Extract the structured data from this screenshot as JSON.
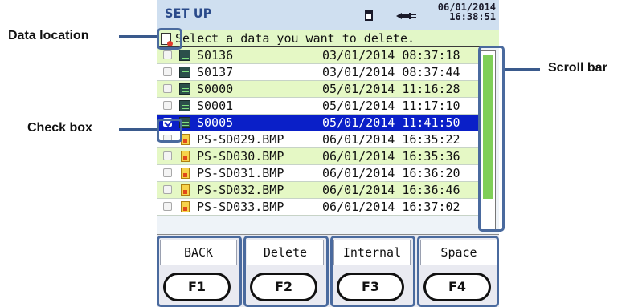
{
  "header": {
    "title": "SET UP",
    "date": "06/01/2014",
    "time": "16:38:51",
    "icons": [
      "sd-card-icon",
      "power-plug-icon"
    ]
  },
  "prompt": "Select a data you want to delete.",
  "files": [
    {
      "name": "S0136",
      "datetime": "03/01/2014 08:37:18",
      "type": "waveform",
      "selected": false
    },
    {
      "name": "S0137",
      "datetime": "03/01/2014 08:37:44",
      "type": "waveform",
      "selected": false
    },
    {
      "name": "S0000",
      "datetime": "05/01/2014 11:16:28",
      "type": "waveform",
      "selected": false
    },
    {
      "name": "S0001",
      "datetime": "05/01/2014 11:17:10",
      "type": "waveform",
      "selected": false
    },
    {
      "name": "S0005",
      "datetime": "05/01/2014 11:41:50",
      "type": "waveform",
      "selected": true
    },
    {
      "name": "PS-SD029.BMP",
      "datetime": "06/01/2014 16:35:22",
      "type": "bmp",
      "selected": false
    },
    {
      "name": "PS-SD030.BMP",
      "datetime": "06/01/2014 16:35:36",
      "type": "bmp",
      "selected": false
    },
    {
      "name": "PS-SD031.BMP",
      "datetime": "06/01/2014 16:36:20",
      "type": "bmp",
      "selected": false
    },
    {
      "name": "PS-SD032.BMP",
      "datetime": "06/01/2014 16:36:46",
      "type": "bmp",
      "selected": false
    },
    {
      "name": "PS-SD033.BMP",
      "datetime": "06/01/2014 16:37:02",
      "type": "bmp",
      "selected": false
    }
  ],
  "function_keys": [
    {
      "label": "BACK",
      "key": "F1"
    },
    {
      "label": "Delete",
      "key": "F2"
    },
    {
      "label": "Internal",
      "key": "F3"
    },
    {
      "label": "Space",
      "key": "F4"
    }
  ],
  "callouts": {
    "data_location": "Data location",
    "check_box": "Check box",
    "scroll_bar": "Scroll bar"
  },
  "colors": {
    "header_bg": "#cfdff0",
    "row_alt": "#e5f8c5",
    "selected_row": "#0a1fc8",
    "scroll_thumb": "#7fcf58",
    "callout_frame": "#4a6a9e"
  }
}
